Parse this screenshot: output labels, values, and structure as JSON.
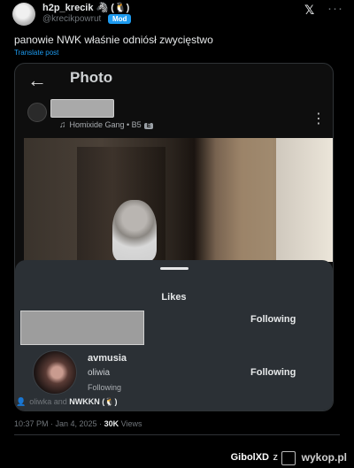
{
  "tweet": {
    "author_name": "h2p_krecik 🦓 (🐧)",
    "handle": "@krecikpowrut",
    "mod_badge": "Mod",
    "text": "panowie NWK właśnie odniósł zwycięstwo",
    "translate": "Translate post",
    "liked_prefix": "oliwka and",
    "liked_bold": "NWKKN (🐧)",
    "timestamp": "10:37 PM · Jan 4, 2025 ·",
    "views_count": "30K",
    "views_label": "Views"
  },
  "embedded": {
    "screen_title": "Photo",
    "song": "Homixide Gang • B5",
    "explicit_badge": "E",
    "likes_title": "Likes",
    "users": [
      {
        "follow_label": "Following"
      },
      {
        "username": "avmusia",
        "display_name": "oliwia",
        "status": "Following",
        "follow_label": "Following"
      }
    ]
  },
  "watermark": {
    "user": "GibolXD",
    "separator": "z",
    "site": "wykop.pl"
  },
  "icons": {
    "x_logo": "x-logo-icon",
    "more": "more-horizontal-icon",
    "back": "back-arrow-icon",
    "music": "music-note-icon",
    "kebab": "more-vertical-icon",
    "person": "person-icon"
  }
}
